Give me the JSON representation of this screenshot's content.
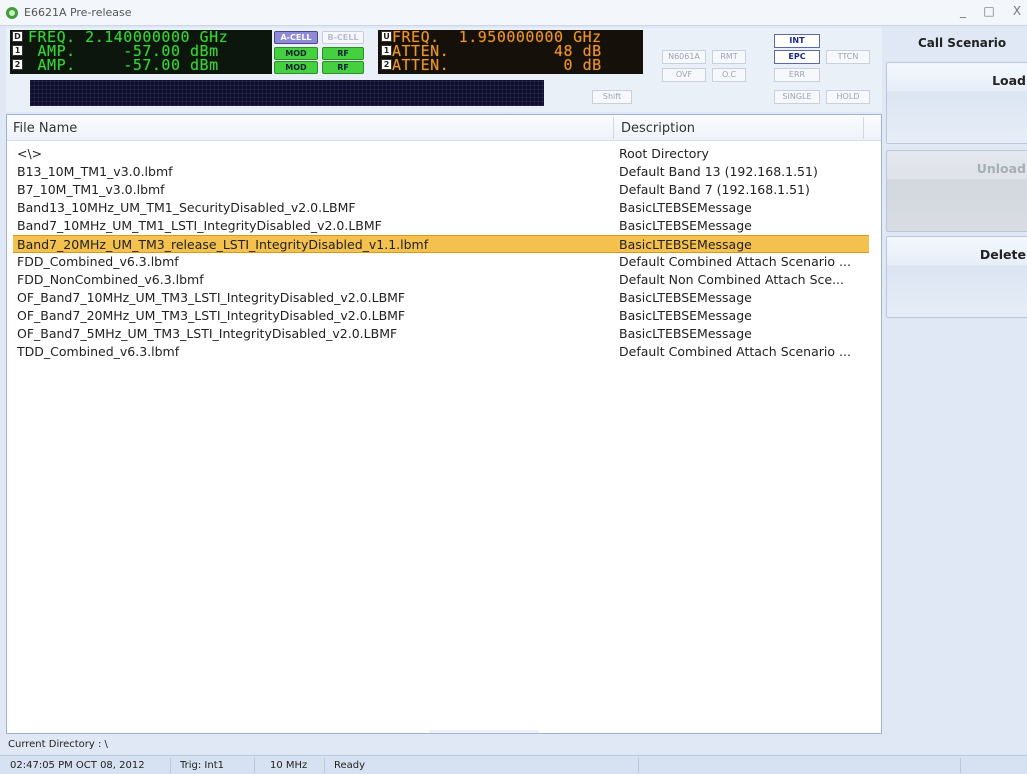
{
  "window": {
    "title": "E6621A Pre-release",
    "controls": [
      "_",
      "□",
      "X"
    ]
  },
  "panel": {
    "left_rows": [
      "D",
      "1",
      "2"
    ],
    "left_lines": [
      "FREQ. 2.140000000 GHz",
      " AMP.     -57.00 dBm",
      " AMP.     -57.00 dBm"
    ],
    "right_rows": [
      "U",
      "1",
      "2"
    ],
    "right_lines": [
      "FREQ.  1.950000000 GHz",
      "ATTEN.           48 dB",
      "ATTEN.            0 dB"
    ],
    "cell_a": "A-CELL",
    "cell_b": "B-CELL",
    "mod": "MOD",
    "rf": "RF",
    "buttons": {
      "n6061a": "N6061A",
      "rmt": "RMT",
      "int": "INT",
      "epc": "EPC",
      "ttcn": "TTCN",
      "ovf": "OVF",
      "oc": "O.C",
      "err": "ERR",
      "shift": "Shift",
      "single": "SINGLE",
      "hold": "HOLD"
    }
  },
  "filelist": {
    "columns": {
      "name": "File Name",
      "description": "Description"
    },
    "rows": [
      {
        "name": "<\\>",
        "description": "Root Directory"
      },
      {
        "name": "B13_10M_TM1_v3.0.lbmf",
        "description": "Default Band 13 (192.168.1.51)"
      },
      {
        "name": "B7_10M_TM1_v3.0.lbmf",
        "description": "Default Band 7 (192.168.1.51)"
      },
      {
        "name": "Band13_10MHz_UM_TM1_SecurityDisabled_v2.0.LBMF",
        "description": "BasicLTEBSEMessage"
      },
      {
        "name": "Band7_10MHz_UM_TM1_LSTI_IntegrityDisabled_v2.0.LBMF",
        "description": "BasicLTEBSEMessage"
      },
      {
        "name": "Band7_20MHz_UM_TM3_release_LSTI_IntegrityDisabled_v1.1.lbmf",
        "description": "BasicLTEBSEMessage"
      },
      {
        "name": "FDD_Combined_v6.3.lbmf",
        "description": "Default Combined Attach Scenario ..."
      },
      {
        "name": "FDD_NonCombined_v6.3.lbmf",
        "description": "Default Non Combined Attach Sce..."
      },
      {
        "name": "OF_Band7_10MHz_UM_TM3_LSTI_IntegrityDisabled_v2.0.LBMF",
        "description": "BasicLTEBSEMessage"
      },
      {
        "name": "OF_Band7_20MHz_UM_TM3_LSTI_IntegrityDisabled_v2.0.LBMF",
        "description": "BasicLTEBSEMessage"
      },
      {
        "name": "OF_Band7_5MHz_UM_TM3_LSTI_IntegrityDisabled_v2.0.LBMF",
        "description": "BasicLTEBSEMessage"
      },
      {
        "name": "TDD_Combined_v6.3.lbmf",
        "description": "Default Combined Attach Scenario ..."
      }
    ],
    "selected_index": 5
  },
  "sidebar": {
    "heading": "Call Scenario",
    "load": "Load",
    "unload": "Unload",
    "delete": "Delete"
  },
  "current_directory": "Current Directory : \\",
  "status": {
    "datetime": "02:47:05 PM OCT 08, 2012",
    "trig": "Trig: Int1",
    "bandwidth": "10 MHz",
    "state": "Ready"
  },
  "colors": {
    "selected_row": "#f4c04e",
    "lcd_green": "#3bd13b",
    "lcd_orange": "#e8962c",
    "acell": "#8e8ad8",
    "mod_rf": "#45d13f"
  }
}
